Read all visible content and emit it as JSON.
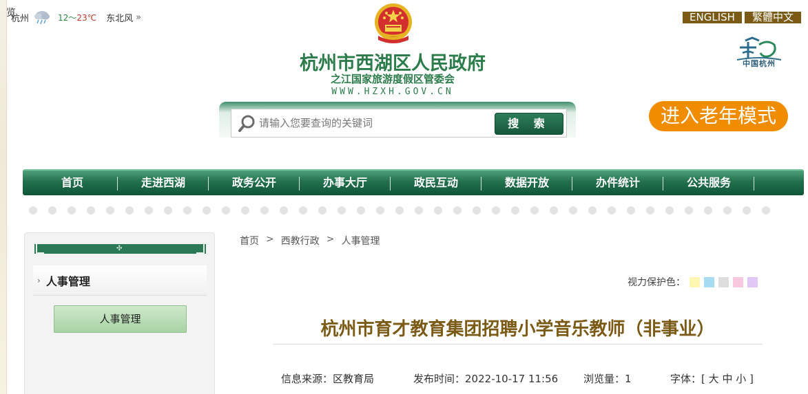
{
  "corner_char": "览",
  "weather": {
    "city": "杭州",
    "temp_low": "12",
    "temp_sep": "～",
    "temp_high": "23℃",
    "wind": "东北风",
    "more": "»",
    "icon": "cloud-rain-icon"
  },
  "header": {
    "title": "杭州市西湖区人民政府",
    "subtitle": "之江国家旅游度假区管委会",
    "url": "WWW.HZXH.GOV.CN",
    "english": "ENGLISH",
    "traditional": "繁體中文",
    "hz_logo_text": "中国杭州"
  },
  "search": {
    "placeholder": "请输入您要查询的关键词",
    "button": "搜 索"
  },
  "elder_mode": "进入老年模式",
  "nav": [
    "首页",
    "走进西湖",
    "政务公开",
    "办事大厅",
    "政民互动",
    "数据开放",
    "办件统计",
    "公共服务"
  ],
  "sidebar": {
    "heading": "人事管理",
    "items": [
      "人事管理"
    ]
  },
  "breadcrumb": {
    "items": [
      "首页",
      "西教行政",
      "人事管理"
    ],
    "separator": ">"
  },
  "eye_care": {
    "label": "视力保护色：",
    "colors": [
      "#fdf7b2",
      "#a8dcf2",
      "#dedede",
      "#f8c8de",
      "#e1c8f4"
    ]
  },
  "article": {
    "title": "杭州市育才教育集团招聘小学音乐教师（非事业）",
    "source_label": "信息来源：",
    "source": "区教育局",
    "time_label": "发布时间：",
    "time": "2022-10-17 11:56",
    "views_label": "浏览量：",
    "views": "1",
    "font_label": "字体：",
    "font_open": "[",
    "font_large": "大",
    "font_medium": "中",
    "font_small": "小",
    "font_close": "]"
  },
  "colors": {
    "brand_green": "#2b7c4a",
    "nav_green": "#22704d",
    "accent_orange": "#f08c00",
    "title_brown": "#7a5a14"
  }
}
